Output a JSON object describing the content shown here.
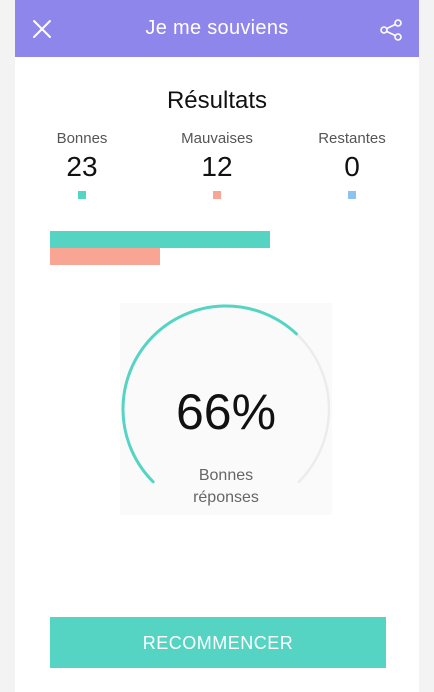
{
  "header": {
    "title": "Je me souviens",
    "close_icon": "close-icon",
    "share_icon": "share-icon",
    "color": "#8f86ec"
  },
  "results": {
    "title": "Résultats",
    "stats": [
      {
        "label": "Bonnes",
        "value": "23",
        "color": "#55d4c4"
      },
      {
        "label": "Mauvaises",
        "value": "12",
        "color": "#f8a593"
      },
      {
        "label": "Restantes",
        "value": "0",
        "color": "#8fc3ef"
      }
    ]
  },
  "bars": {
    "good_count": 23,
    "bad_count": 12,
    "good_color": "#55d4c4",
    "bad_color": "#f8a593"
  },
  "gauge": {
    "percent_text": "66%",
    "percent_value": 0.66,
    "line1": "Bonnes",
    "line2": "réponses",
    "arc_color": "#55d4c4",
    "track_color": "#ececec"
  },
  "actions": {
    "restart_label": "RECOMMENCER",
    "restart_color": "#55d4c4"
  }
}
